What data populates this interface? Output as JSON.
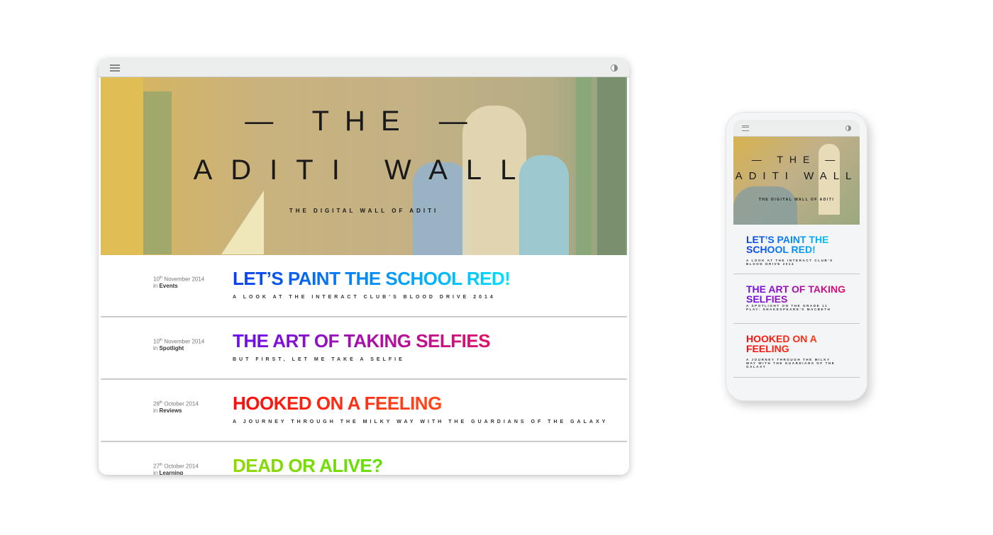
{
  "site": {
    "title_line1": "— THE —",
    "title_line2": "ADITI WALL",
    "tagline": "THE DIGITAL WALL OF ADITI"
  },
  "icons": {
    "menu": "hamburger-menu-icon",
    "theme": "contrast-toggle-icon"
  },
  "posts": [
    {
      "day": "10",
      "suffix": "th",
      "month_year": "November 2014",
      "in": "in",
      "category": "Events",
      "title": "LET’S PAINT THE SCHOOL RED!",
      "subtitle": "A look at the Interact Club’s Blood Drive 2014",
      "gradient": [
        "#0a3cf0",
        "#00e0ff"
      ]
    },
    {
      "day": "10",
      "suffix": "th",
      "month_year": "November 2014",
      "in": "in",
      "category": "Spotlight",
      "title": "THE ART OF TAKING SELFIES",
      "subtitle": "But first, let me take a selfie",
      "gradient": [
        "#6a10f0",
        "#e0106a"
      ]
    },
    {
      "day": "28",
      "suffix": "th",
      "month_year": "October 2014",
      "in": "in",
      "category": "Reviews",
      "title": "HOOKED ON A FEELING",
      "subtitle": "A journey through the Milky Way with the Guardians of the Galaxy",
      "gradient": [
        "#ff0a0a",
        "#ff4a1a"
      ]
    },
    {
      "day": "27",
      "suffix": "th",
      "month_year": "October 2014",
      "in": "in",
      "category": "Learning",
      "title": "DEAD OR ALIVE?",
      "subtitle": "",
      "gradient": [
        "#8fd800",
        "#5ee000"
      ]
    }
  ],
  "mobile_posts": [
    {
      "title": "LET’S PAINT THE SCHOOL RED!",
      "subtitle": "A look at the Interact Club’s Blood Drive 2014"
    },
    {
      "title": "THE ART OF TAKING SELFIES",
      "subtitle": "A spotlight on the Grade 11 play: Shakespeare’s Macbeth"
    },
    {
      "title": "HOOKED ON A FEELING",
      "subtitle": "A journey through the Milky Way with the Guardians of the Galaxy"
    }
  ]
}
